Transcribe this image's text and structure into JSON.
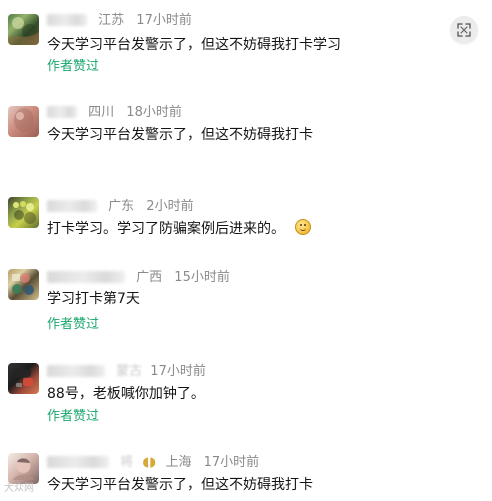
{
  "toolbar": {
    "expand_icon": "expand-icon"
  },
  "comments": [
    {
      "meta": {
        "name_tail": "",
        "region": "江苏",
        "time": "17小时前"
      },
      "text": "今天学习平台发警示了，但这不妨碍我打卡学习",
      "liked": "作者赞过"
    },
    {
      "meta": {
        "name_tail": "",
        "region": "四川",
        "time": "18小时前"
      },
      "text": "今天学习平台发警示了，但这不妨碍我打卡",
      "liked": ""
    },
    {
      "meta": {
        "name_tail": "",
        "region": "广东",
        "time": "2小时前"
      },
      "text": "打卡学习。学习了防骗案例后进来的。",
      "liked": ""
    },
    {
      "meta": {
        "name_tail": "",
        "region": "广西",
        "time": "15小时前"
      },
      "text": "学习打卡第7天",
      "liked": "作者赞过"
    },
    {
      "meta": {
        "name_tail": "蒙古",
        "region": "",
        "time": "17小时前"
      },
      "text": "88号，老板喊你加钟了。",
      "liked": "作者赞过"
    },
    {
      "meta": {
        "name_tail": "将",
        "region": "上海",
        "time": "17小时前"
      },
      "text": "今天学习平台发警示了，但这不妨碍我打卡",
      "liked": ""
    }
  ],
  "watermark": "大众网"
}
